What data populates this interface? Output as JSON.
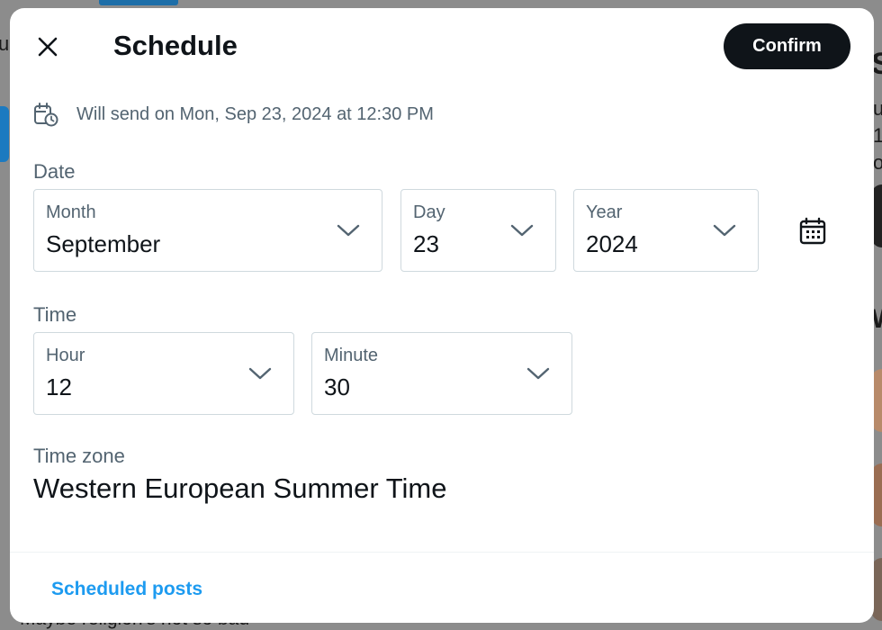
{
  "background": {
    "peek_left_1": "u",
    "peek_right_1": "S",
    "peek_right_2": "W",
    "peek_right_3": "u",
    "peek_right_4": "1",
    "peek_right_5": "o",
    "peek_bottom": "Maybe religion's not so bad"
  },
  "header": {
    "title": "Schedule",
    "confirm_label": "Confirm"
  },
  "schedule_summary": "Will send on Mon, Sep 23, 2024 at 12:30 PM",
  "date": {
    "label": "Date",
    "month": {
      "label": "Month",
      "value": "September"
    },
    "day": {
      "label": "Day",
      "value": "23"
    },
    "year": {
      "label": "Year",
      "value": "2024"
    }
  },
  "time": {
    "label": "Time",
    "hour": {
      "label": "Hour",
      "value": "12"
    },
    "minute": {
      "label": "Minute",
      "value": "30"
    }
  },
  "timezone": {
    "label": "Time zone",
    "value": "Western European Summer Time"
  },
  "footer": {
    "scheduled_posts_label": "Scheduled posts"
  },
  "colors": {
    "accent": "#1d9bf0",
    "primary_button": "#0f1419",
    "secondary_text": "#536471"
  }
}
